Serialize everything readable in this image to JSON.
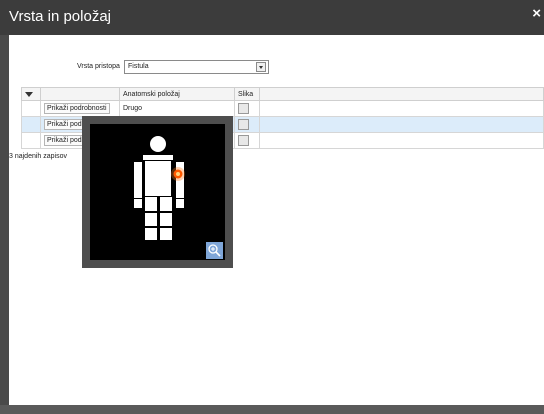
{
  "window": {
    "title": "Vrsta in položaj",
    "close_icon": "×"
  },
  "form": {
    "type_label": "Vrsta pristopa",
    "type_value": "Fistula"
  },
  "table": {
    "headers": {
      "position": "Anatomski položaj",
      "image": "Slika"
    },
    "rows": [
      {
        "details": "Prikaži podrobnosti",
        "position": "Drugo"
      },
      {
        "details": "Prikaži podrobnosti",
        "position": ""
      },
      {
        "details": "Prikaži podrobnosti",
        "position": ""
      }
    ]
  },
  "records_count": "3 najdenih zapisov",
  "popup": {
    "marker_color": "#ff7a1a",
    "zoom_icon": "zoom-in-icon"
  }
}
